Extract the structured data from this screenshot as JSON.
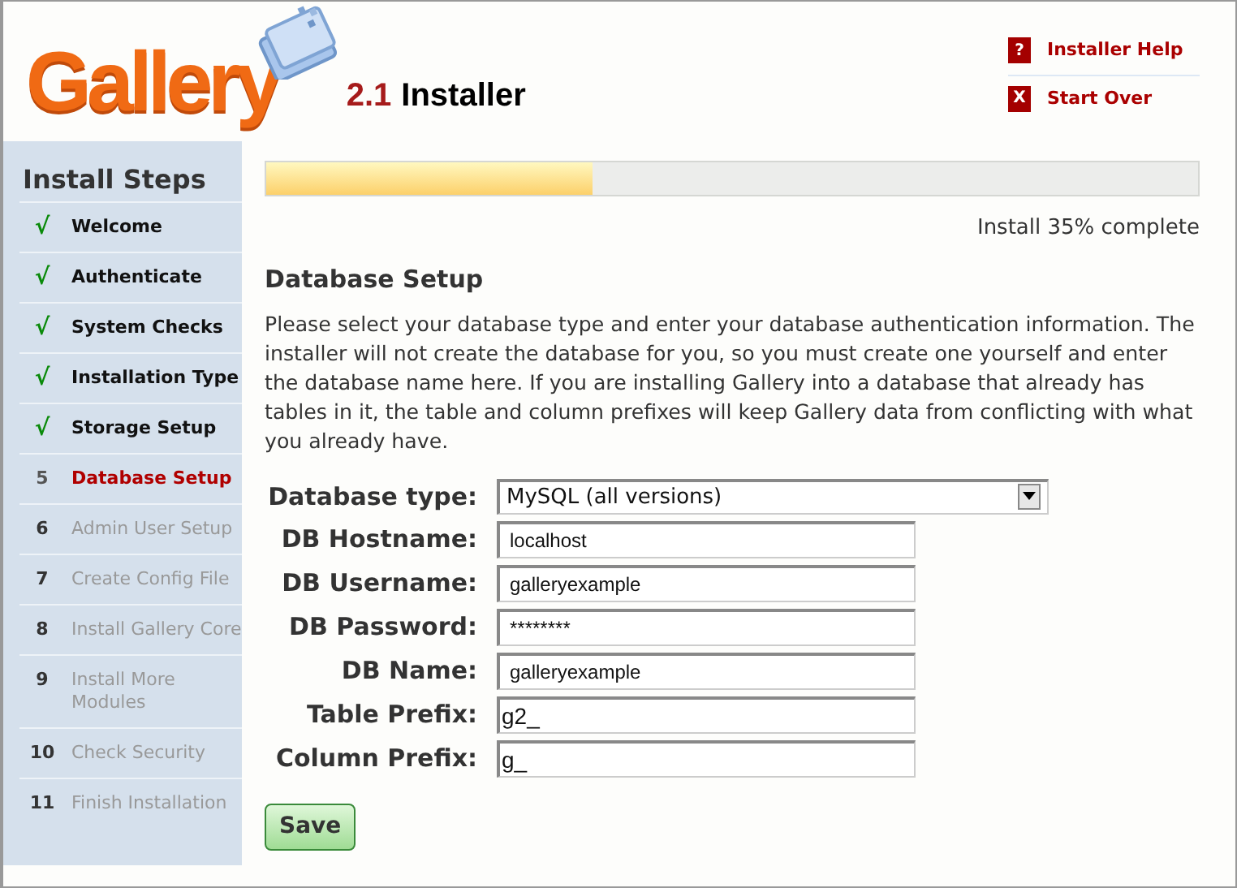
{
  "logo": {
    "word": "Gallery",
    "version": "2.1",
    "title": "Installer"
  },
  "header_links": [
    {
      "marker": "?",
      "label": "Installer Help"
    },
    {
      "marker": "X",
      "label": "Start Over"
    }
  ],
  "sidebar": {
    "title": "Install Steps",
    "steps": [
      {
        "marker": "√",
        "label": "Welcome",
        "completed": true,
        "selected": false
      },
      {
        "marker": "√",
        "label": "Authenticate",
        "completed": true,
        "selected": false
      },
      {
        "marker": "√",
        "label": "System Checks",
        "completed": true,
        "selected": false
      },
      {
        "marker": "√",
        "label": "Installation Type",
        "completed": true,
        "selected": false
      },
      {
        "marker": "√",
        "label": "Storage Setup",
        "completed": true,
        "selected": false
      },
      {
        "marker": "5",
        "label": "Database Setup",
        "completed": false,
        "selected": true
      },
      {
        "marker": "6",
        "label": "Admin User Setup",
        "completed": false,
        "selected": false
      },
      {
        "marker": "7",
        "label": "Create Config File",
        "completed": false,
        "selected": false
      },
      {
        "marker": "8",
        "label": "Install Gallery Core",
        "completed": false,
        "selected": false
      },
      {
        "marker": "9",
        "label": "Install More Modules",
        "completed": false,
        "selected": false
      },
      {
        "marker": "10",
        "label": "Check Security",
        "completed": false,
        "selected": false
      },
      {
        "marker": "11",
        "label": "Finish Installation",
        "completed": false,
        "selected": false
      }
    ]
  },
  "progress": {
    "level": 0.35,
    "caption": "Install 35% complete"
  },
  "heading": "Database Setup",
  "intro": "Please select your database type and enter your database authentication information. The installer will not create the database for you, so you must create one yourself and enter the database name here. If you are installing Gallery into a database that already has tables in it, the table and column prefixes will keep Gallery data from conflicting with what you already have.",
  "fields": [
    {
      "label": "Database type:",
      "value": "MySQL (all versions)",
      "kind": "select"
    },
    {
      "label": "DB Hostname:",
      "value": "localhost",
      "kind": "text"
    },
    {
      "label": "DB Username:",
      "value": "galleryexample",
      "kind": "text"
    },
    {
      "label": "DB Password:",
      "value": "********",
      "kind": "text"
    },
    {
      "label": "DB Name:",
      "value": "galleryexample",
      "kind": "text"
    },
    {
      "label": "Table Prefix:",
      "value": "g2_",
      "kind": "prefix"
    },
    {
      "label": "Column Prefix:",
      "value": "g_",
      "kind": "prefix"
    }
  ],
  "save_button": "Save"
}
